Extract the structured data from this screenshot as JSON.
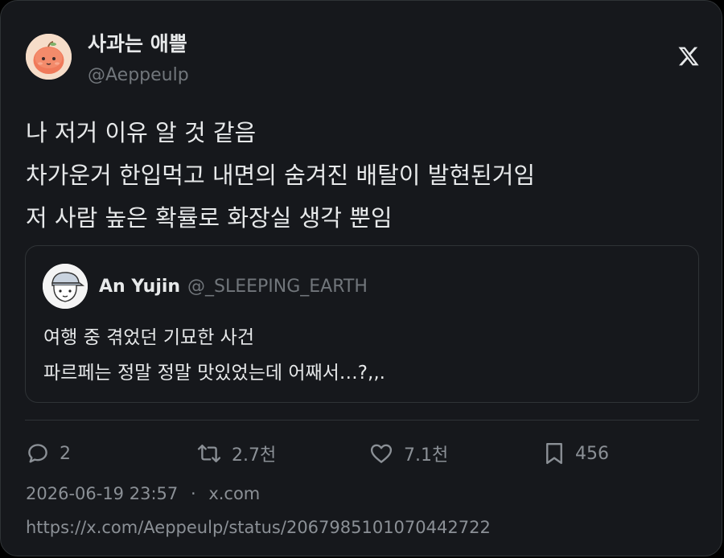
{
  "author": {
    "display_name": "사과는 애쁠",
    "handle": "@Aeppeulp",
    "avatar_icon": "apple-character-avatar"
  },
  "brand": {
    "icon": "x-logo-icon",
    "color": "#e7e9ea"
  },
  "tweet": {
    "lines": [
      "나 저거 이유 알 것 같음",
      "차가운거 한입먹고 내면의 숨겨진 배탈이 발현된거임",
      "저 사람 높은 확률로 화장실 생각 뿐임"
    ]
  },
  "quote": {
    "display_name": "An Yujin",
    "handle": "@_SLEEPING_EARTH",
    "avatar_icon": "cap-character-avatar",
    "lines": [
      "여행 중 겪었던 기묘한 사건",
      "파르페는 정말 정말 맛있었는데 어째서…?,,."
    ]
  },
  "actions": {
    "reply": {
      "icon": "reply-icon",
      "count": "2"
    },
    "retweet": {
      "icon": "retweet-icon",
      "count": "2.7천"
    },
    "like": {
      "icon": "heart-icon",
      "count": "7.1천"
    },
    "bookmark": {
      "icon": "bookmark-icon",
      "count": "456"
    }
  },
  "meta": {
    "timestamp": "2026-06-19 23:57",
    "separator": "·",
    "source": "x.com",
    "url": "https://x.com/Aeppeulp/status/2067985101070442722"
  },
  "colors": {
    "card_background": "#16181c",
    "border": "#2f3336",
    "primary_text": "#e7e9ea",
    "secondary_text": "#71767b"
  }
}
